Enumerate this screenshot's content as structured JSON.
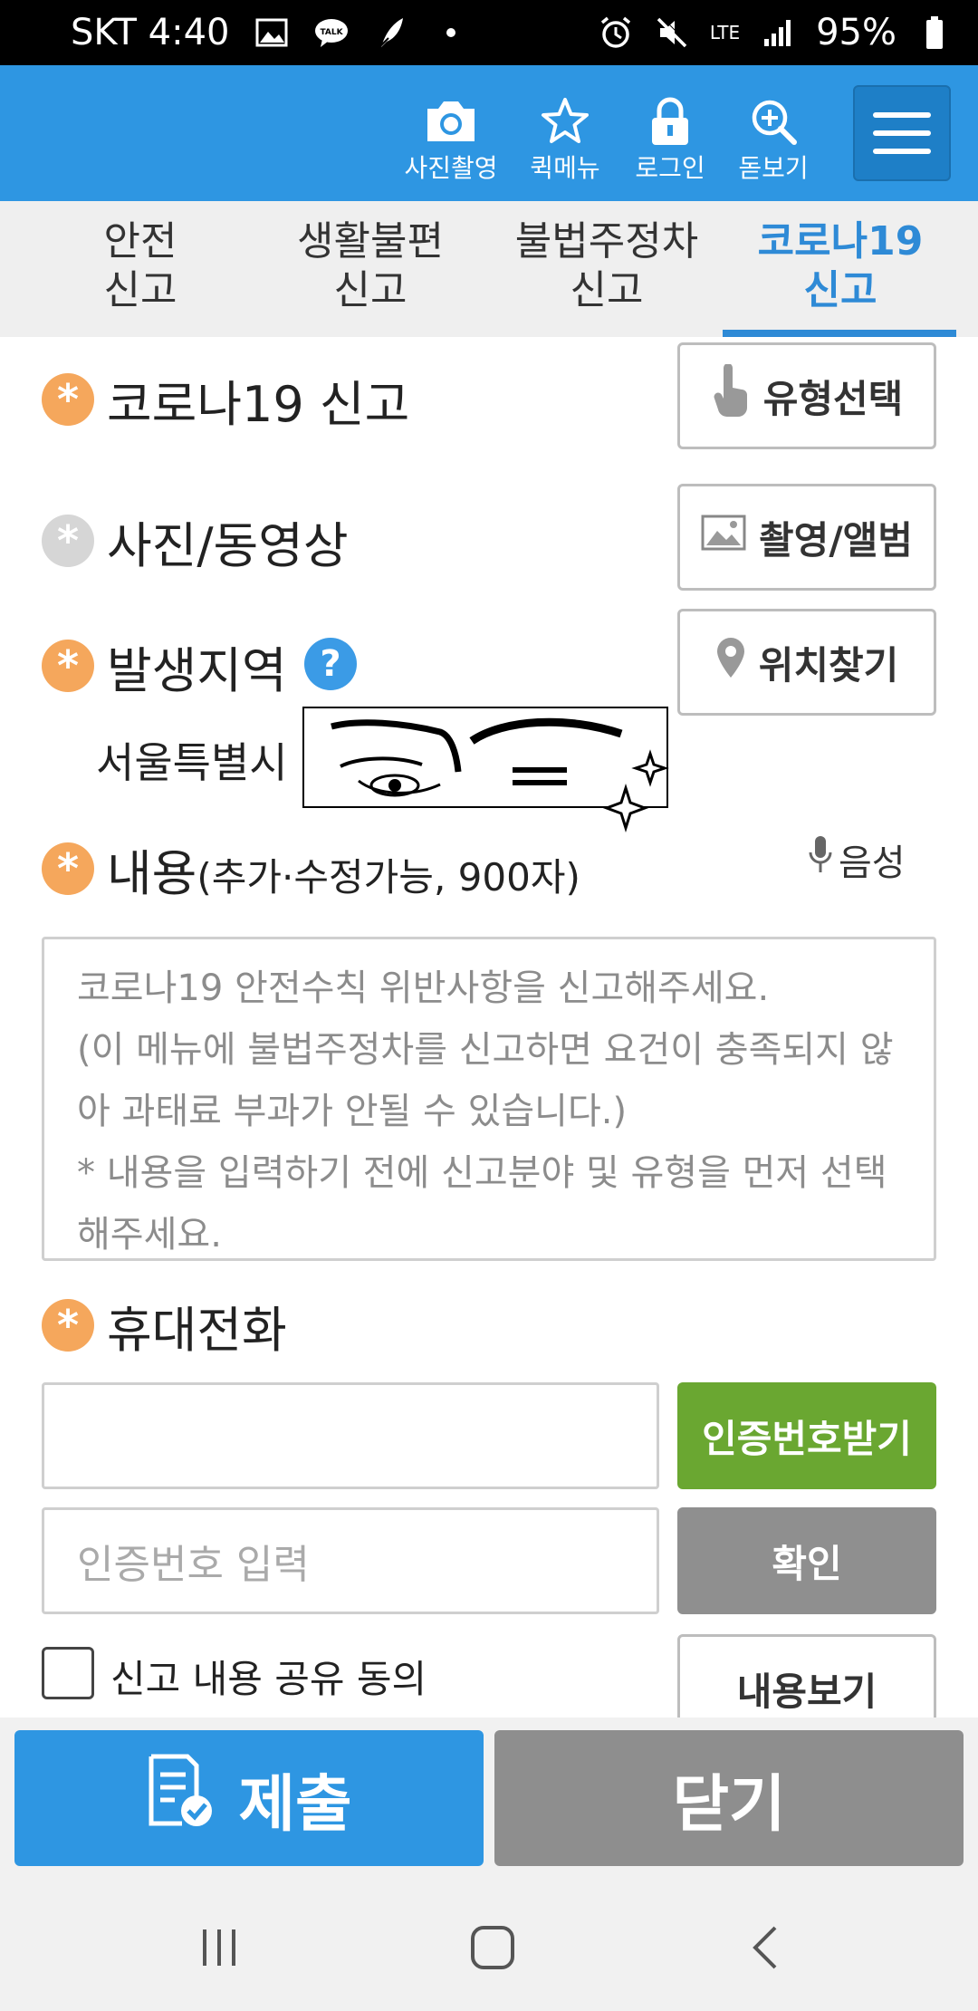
{
  "status_bar": {
    "carrier_time": "SKT 4:40",
    "network": "LTE",
    "battery": "95%",
    "icons": [
      "image-icon",
      "talk-icon",
      "quill-icon",
      "dot-icon",
      "alarm-icon",
      "mute-icon",
      "signal-icon",
      "battery-icon"
    ]
  },
  "appbar": {
    "actions": [
      {
        "label": "사진촬영",
        "icon": "camera-icon"
      },
      {
        "label": "퀵메뉴",
        "icon": "star-icon"
      },
      {
        "label": "로그인",
        "icon": "lock-icon"
      },
      {
        "label": "돋보기",
        "icon": "magnifier-plus-icon"
      }
    ],
    "menu_icon": "hamburger-icon",
    "accent": "#2e96e2"
  },
  "tabs": [
    {
      "line1": "안전",
      "line2": "신고"
    },
    {
      "line1": "생활불편",
      "line2": "신고"
    },
    {
      "line1": "불법주정차",
      "line2": "신고"
    },
    {
      "line1": "코로나19",
      "line2": "신고",
      "active": true
    }
  ],
  "form": {
    "covid": {
      "label": "코로나19 신고",
      "button": "유형선택",
      "button_icon": "hand-pointer-icon"
    },
    "media": {
      "label": "사진/동영상",
      "button": "촬영/앨범",
      "button_icon": "picture-icon"
    },
    "location": {
      "label": "발생지역",
      "help": "?",
      "button": "위치찾기",
      "button_icon": "location-pin-icon",
      "value": "서울특별시"
    },
    "content": {
      "label": "내용",
      "sub": "(추가·수정가능, 900자)",
      "voice": "음성",
      "voice_icon": "microphone-icon",
      "placeholder": "코로나19 안전수칙 위반사항을 신고해주세요.\n(이 메뉴에 불법주정차를 신고하면 요건이 충족되지 않아 과태료 부과가 안될 수 있습니다.)\n* 내용을 입력하기 전에 신고분야 및 유형을 먼저 선택해주세요."
    },
    "phone": {
      "label": "휴대전화",
      "value": "",
      "request_button": "인증번호받기",
      "code_placeholder": "인증번호 입력",
      "confirm_button": "확인"
    },
    "share": {
      "label": "신고 내용 공유 동의",
      "checked": false,
      "view_button": "내용보기"
    }
  },
  "bottom": {
    "submit": "제출",
    "submit_icon": "document-check-icon",
    "close": "닫기"
  },
  "navbar": {
    "icons": [
      "recent-apps-icon",
      "home-icon",
      "back-icon"
    ]
  }
}
